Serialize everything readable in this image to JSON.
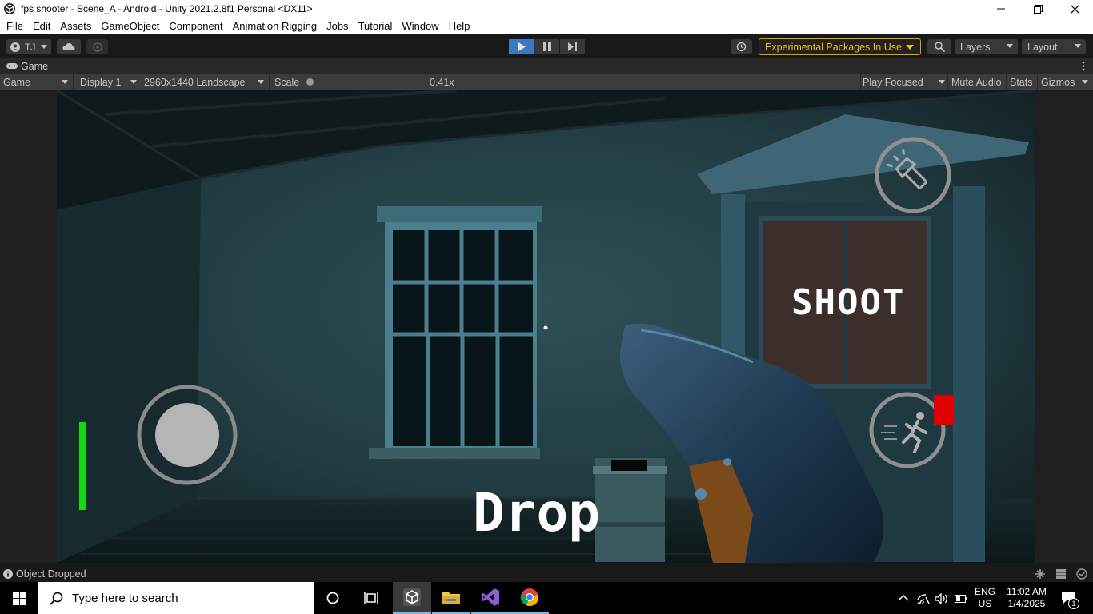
{
  "window": {
    "title": "fps shooter - Scene_A - Android - Unity 2021.2.8f1 Personal <DX11>",
    "minimize_icon": "minimize-icon",
    "restore_icon": "restore-icon",
    "close_icon": "close-icon"
  },
  "menu": {
    "items": [
      "File",
      "Edit",
      "Assets",
      "GameObject",
      "Component",
      "Animation Rigging",
      "Jobs",
      "Tutorial",
      "Window",
      "Help"
    ]
  },
  "toolbar": {
    "account_label": "TJ",
    "play_icon": "play-icon",
    "pause_icon": "pause-icon",
    "step_icon": "step-icon",
    "experimental_label": "Experimental Packages In Use",
    "layers_label": "Layers",
    "layout_label": "Layout"
  },
  "game_tab": {
    "label": "Game"
  },
  "game_bar": {
    "view_mode": "Game",
    "display": "Display 1",
    "resolution": "2960x1440 Landscape",
    "scale_label": "Scale",
    "scale_value": "0.41x",
    "scale_fraction": 0.0,
    "play_focused": "Play Focused",
    "mute_audio": "Mute Audio",
    "stats": "Stats",
    "gizmos": "Gizmos"
  },
  "hud": {
    "shoot_label": "SHOOT",
    "drop_label": "Drop",
    "health_color": "#14d814",
    "flashlight_icon": "flashlight-icon",
    "sprint_icon": "sprint-icon"
  },
  "status": {
    "message": "Object Dropped"
  },
  "taskbar": {
    "search_placeholder": "Type here to search",
    "language": "ENG",
    "region": "US",
    "time": "11:02 AM",
    "date": "1/4/2025",
    "notification_count": "1"
  },
  "colors": {
    "play_active": "#3a79bb",
    "experimental_accent": "#f4b71b",
    "sprint_indicator": "#e00000"
  }
}
